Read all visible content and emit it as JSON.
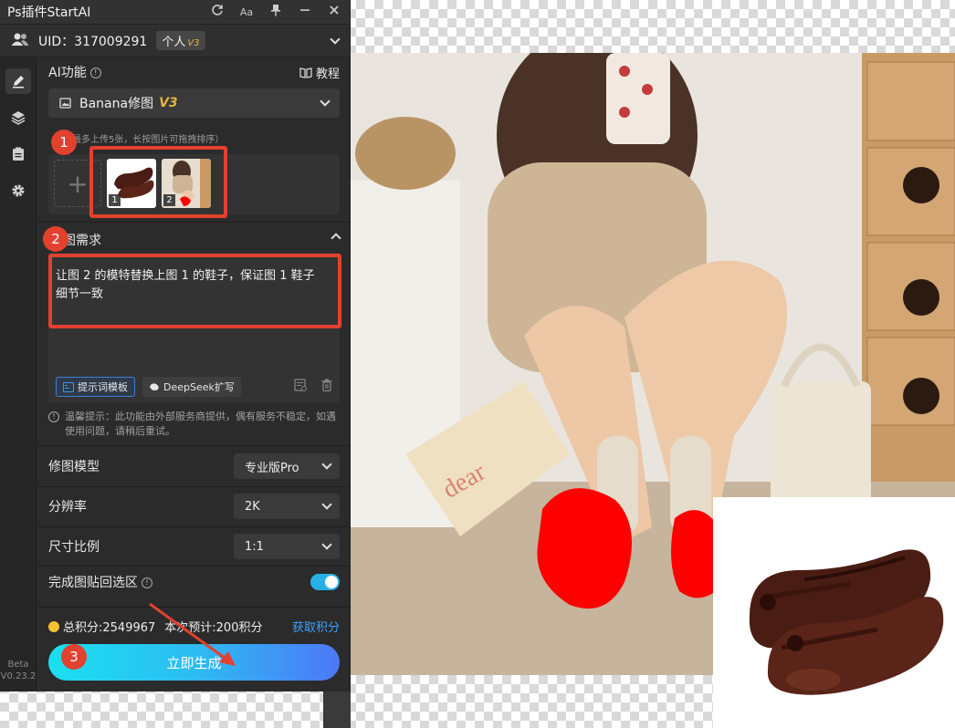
{
  "panel": {
    "title": "Ps插件StartAI",
    "title_icons": [
      "refresh-icon",
      "font-size-icon",
      "pin-icon",
      "minimize-icon",
      "close-icon"
    ],
    "font_icon_text": "Aa",
    "user": {
      "uid": "UID：317009291",
      "plan": "个人",
      "plan_badge": "V3"
    },
    "sidebar": {
      "items": [
        "edit-icon",
        "layers-icon",
        "clipboard-icon",
        "settings-icon"
      ],
      "version_line1": "Beta",
      "version_line2": "V0.23.2"
    },
    "ai": {
      "label": "AI功能",
      "tutorial": "教程",
      "model": "Banana修图",
      "model_badge": "V3"
    },
    "upload": {
      "hint_suffix": "（最多上传5张，长按图片可拖拽排序）",
      "add_symbol": "+",
      "thumbs": [
        {
          "num": "1"
        },
        {
          "num": "2"
        }
      ]
    },
    "requirement": {
      "label_suffix": "图需求",
      "prompt": "让图 2 的模特替换上图 1 的鞋子，保证图 1 鞋子细节一致",
      "template_btn": "提示词模板",
      "deepseek_btn": "DeepSeek扩写"
    },
    "tip": "温馨提示：此功能由外部服务商提供，偶有服务不稳定，如遇使用问题，请稍后重试。",
    "options": {
      "model_label": "修图模型",
      "model_value": "专业版Pro",
      "resolution_label": "分辨率",
      "resolution_value": "2K",
      "ratio_label": "尺寸比例",
      "ratio_value": "1:1",
      "paste_label": "完成图贴回选区",
      "paste_enabled": true
    },
    "points": {
      "total": "总积分:2549967",
      "estimate": "本次预计:200积分",
      "get": "获取积分"
    },
    "generate": "立即生成"
  },
  "annotations": {
    "badges": [
      "1",
      "2",
      "3"
    ],
    "color": "#e2412f"
  },
  "colors": {
    "panel_bg": "#2b2b2b",
    "accent_gold": "#e7b53c",
    "link_blue": "#3aa3ff",
    "toggle_on": "#28b0e6"
  }
}
